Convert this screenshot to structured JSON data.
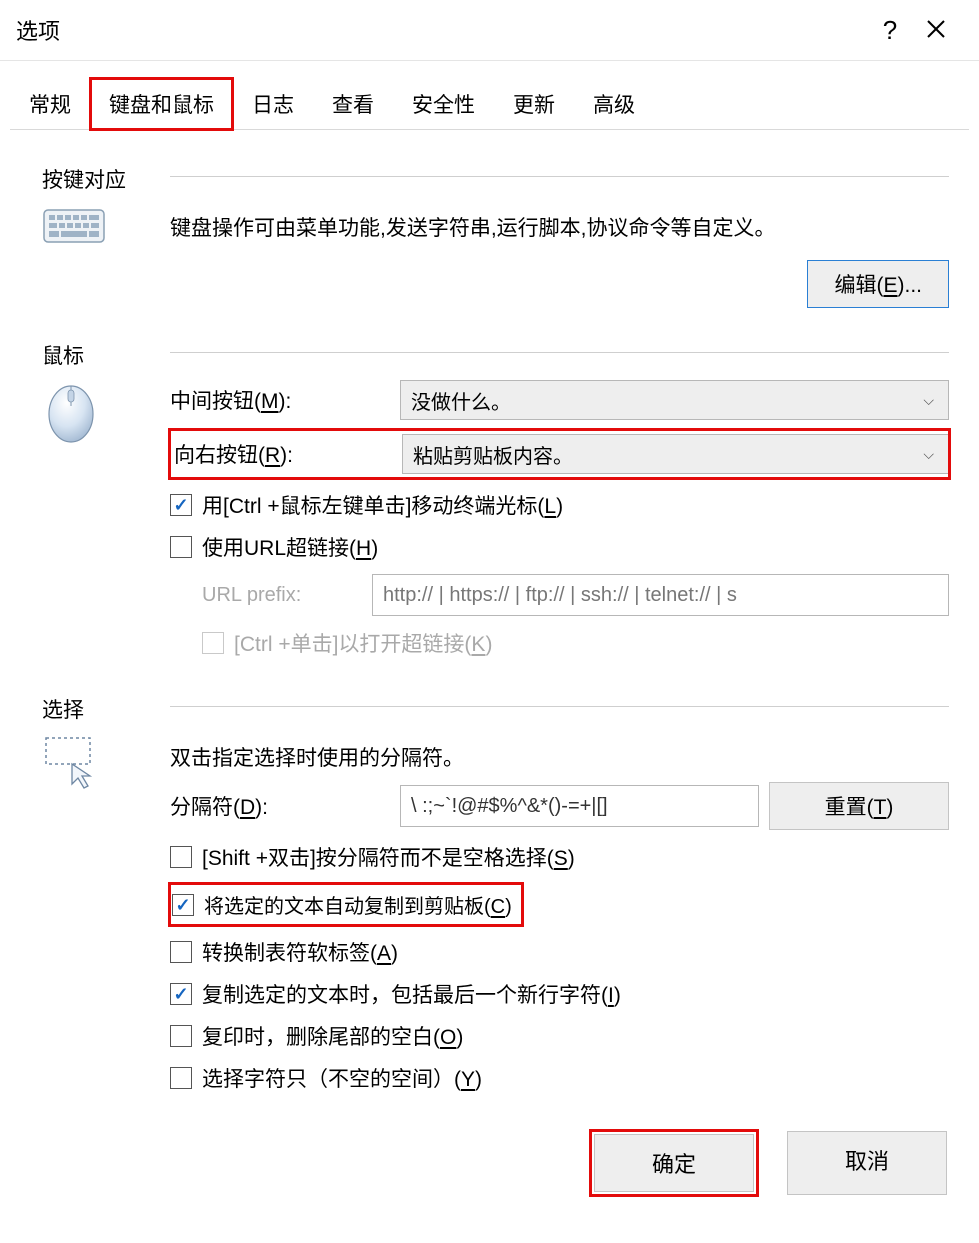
{
  "title": "选项",
  "tabs": [
    "常规",
    "键盘和鼠标",
    "日志",
    "查看",
    "安全性",
    "更新",
    "高级"
  ],
  "active_tab_index": 1,
  "sections": {
    "keymap": {
      "heading": "按键对应",
      "desc": "键盘操作可由菜单功能,发送字符串,运行脚本,协议命令等自定义。",
      "edit_button": "编辑(E)..."
    },
    "mouse": {
      "heading": "鼠标",
      "middle_label": "中间按钮(M):",
      "middle_value": "没做什么。",
      "right_label": "向右按钮(R):",
      "right_value": "粘贴剪贴板内容。",
      "ctrl_click_move": "用[Ctrl +鼠标左键单击]移动终端光标(L)",
      "use_url_link": "使用URL超链接(H)",
      "url_prefix_label": "URL prefix:",
      "url_prefix_value": "http:// | https:// | ftp:// | ssh:// | telnet:// | s",
      "ctrl_click_open": "[Ctrl +单击]以打开超链接(K)"
    },
    "select": {
      "heading": "选择",
      "desc": "双击指定选择时使用的分隔符。",
      "delim_label": "分隔符(D):",
      "delim_value": "\\ :;~`!@#$%^&*()-=+|[]",
      "reset_button": "重置(T)",
      "shift_dbl": "[Shift +双击]按分隔符而不是空格选择(S)",
      "auto_copy": "将选定的文本自动复制到剪贴板(C)",
      "convert_tab": "转换制表符软标签(A)",
      "include_newline": "复制选定的文本时，包括最后一个新行字符(I)",
      "trim_trailing": "复印时，删除尾部的空白(O)",
      "nonblank_only": "选择字符只（不空的空间）(Y)"
    }
  },
  "footer": {
    "ok": "确定",
    "cancel": "取消"
  }
}
